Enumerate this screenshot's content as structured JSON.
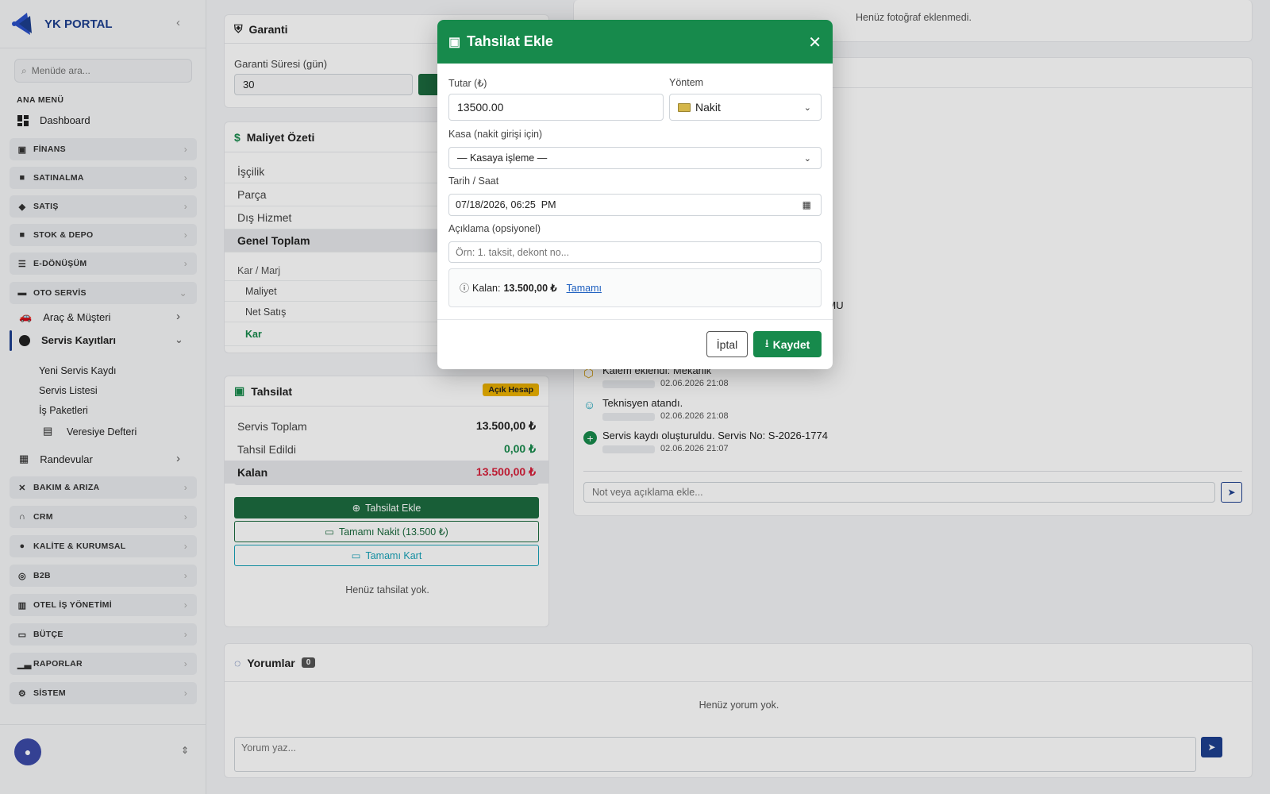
{
  "sidebar": {
    "brand": "YK PORTAL",
    "search_placeholder": "Menüde ara...",
    "menu_heading": "ANA MENÜ",
    "dashboard": "Dashboard",
    "groups": [
      {
        "label": "FİNANS",
        "icon": "finance-icon"
      },
      {
        "label": "SATINALMA",
        "icon": "bag-icon"
      },
      {
        "label": "SATIŞ",
        "icon": "tag-icon"
      },
      {
        "label": "STOK & DEPO",
        "icon": "box-icon"
      },
      {
        "label": "E-DÖNÜŞÜM",
        "icon": "document-icon"
      },
      {
        "label": "OTO SERVİS",
        "icon": "car-icon"
      },
      {
        "label": "BAKIM & ARIZA",
        "icon": "wrench-icon"
      },
      {
        "label": "CRM",
        "icon": "headset-icon"
      },
      {
        "label": "KALİTE & KURUMSAL",
        "icon": "badge-icon"
      },
      {
        "label": "B2B",
        "icon": "globe-icon"
      },
      {
        "label": "OTEL İŞ YÖNETİMİ",
        "icon": "building-icon"
      },
      {
        "label": "BÜTÇE",
        "icon": "wallet-icon"
      },
      {
        "label": "RAPORLAR",
        "icon": "bar-chart-icon"
      },
      {
        "label": "SİSTEM",
        "icon": "gear-icon"
      }
    ],
    "oto_items": {
      "arac": "Araç & Müşteri",
      "servis": "Servis Kayıtları",
      "randevu": "Randevular"
    },
    "servis_sub": [
      "Yeni Servis Kaydı",
      "Servis Listesi",
      "İş Paketleri",
      "Veresiye Defteri"
    ]
  },
  "garanti": {
    "title": "Garanti",
    "label": "Garanti Süresi (gün)",
    "value": "30"
  },
  "maliyet": {
    "title": "Maliyet Özeti",
    "rows": [
      "İşçilik",
      "Parça",
      "Dış Hizmet"
    ],
    "total": "Genel Toplam",
    "kar_marj": "Kar / Marj",
    "maliyet": "Maliyet",
    "net_satis": "Net Satış",
    "kar": "Kar"
  },
  "tahsilat": {
    "title": "Tahsilat",
    "badge": "Açık Hesap",
    "servis_toplam_label": "Servis Toplam",
    "servis_toplam": "13.500,00 ₺",
    "tahsil_label": "Tahsil Edildi",
    "tahsil": "0,00 ₺",
    "kalan_label": "Kalan",
    "kalan": "13.500,00 ₺",
    "progress": 0,
    "btn_ekle": "Tahsilat Ekle",
    "btn_nakit": "Tamamı Nakit (13.500 ₺)",
    "btn_kart": "Tamamı Kart",
    "empty": "Henüz tahsilat yok."
  },
  "photos": {
    "empty": "Henüz fotoğraf eklenmedi."
  },
  "timeline": {
    "partial": "UMU",
    "events": [
      {
        "text": "Kalem eklendi: Mekanik",
        "time": "02.06.2026 21:08",
        "icon": "box-icon"
      },
      {
        "text": "Teknisyen atandı.",
        "time": "02.06.2026 21:08",
        "icon": "user-check-icon"
      },
      {
        "text": "Servis kaydı oluşturuldu. Servis No: S-2026-1774",
        "time": "02.06.2026 21:07",
        "icon": "plus-circle-icon"
      }
    ],
    "note_placeholder": "Not veya açıklama ekle..."
  },
  "yorumlar": {
    "title": "Yorumlar",
    "count": "0",
    "empty": "Henüz yorum yok.",
    "placeholder": "Yorum yaz..."
  },
  "modal": {
    "title": "Tahsilat Ekle",
    "tutar_label": "Tutar (₺)",
    "tutar": "13500.00",
    "yontem_label": "Yöntem",
    "yontem": "Nakit",
    "kasa_label": "Kasa (nakit girişi için)",
    "kasa": "— Kasaya işleme —",
    "tarih_label": "Tarih / Saat",
    "tarih": "07/18/2026, 06:25  PM",
    "aciklama_label": "Açıklama (opsiyonel)",
    "aciklama_placeholder": "Örn: 1. taksit, dekont no...",
    "kalan_prefix": "Kalan:",
    "kalan": "13.500,00 ₺",
    "tamami": "Tamamı",
    "iptal": "İptal",
    "kaydet": "Kaydet"
  },
  "colors": {
    "primary": "#178a4c",
    "dark_green": "#1c6b3f",
    "brand": "#1d3f8f",
    "danger": "#d61f3a",
    "info": "#17a2b8",
    "badge": "#f0b400"
  }
}
